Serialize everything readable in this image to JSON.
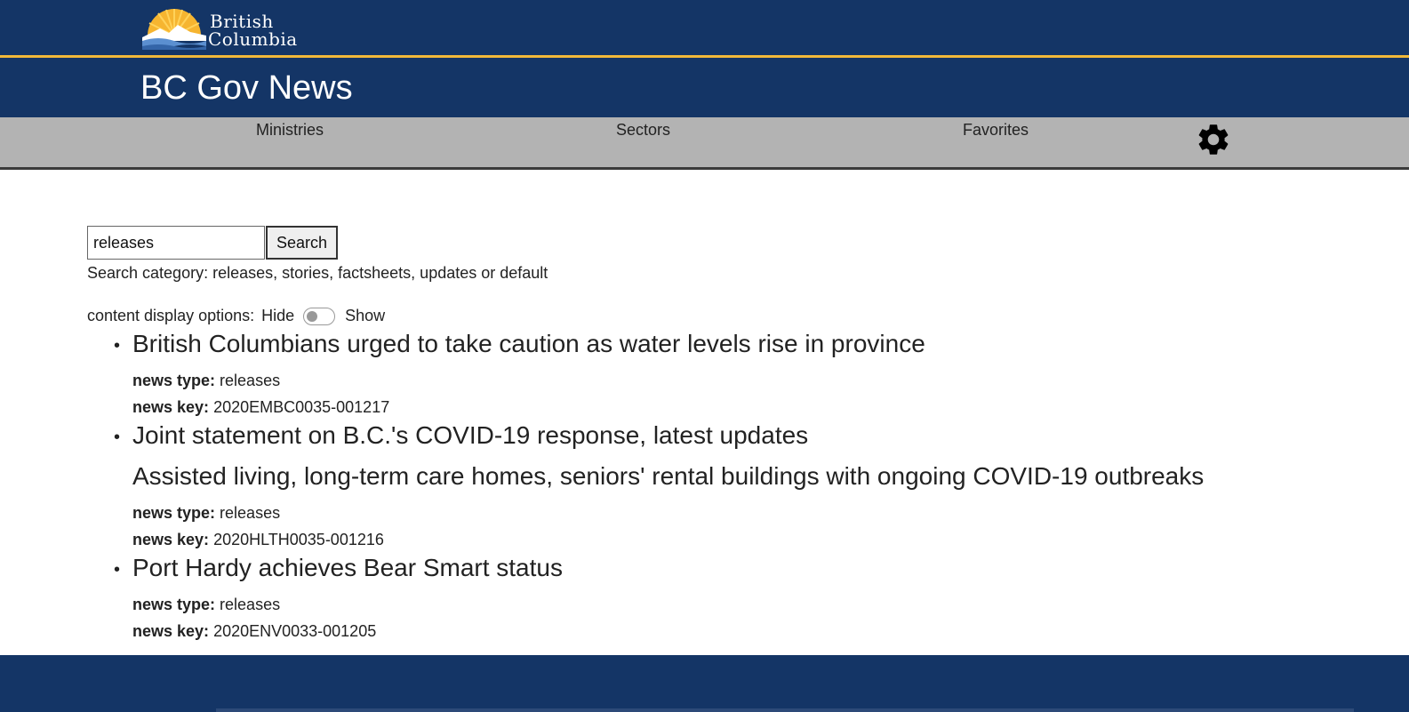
{
  "colors": {
    "header_bg": "#143566",
    "gold_accent": "#f1b83a",
    "nav_bg": "#b3b3b3"
  },
  "logo": {
    "line1": "British",
    "line2": "Columbia",
    "icon": "bc-sunset-logo-icon"
  },
  "header": {
    "title": "BC Gov News"
  },
  "nav": {
    "ministries": "Ministries",
    "sectors": "Sectors",
    "favorites": "Favorites",
    "settings_icon": "gear-icon"
  },
  "search": {
    "value": "releases",
    "button_label": "Search",
    "hint": "Search category: releases, stories, factsheets, updates or default"
  },
  "display_options": {
    "label": "content display options:",
    "hide": "Hide",
    "show": "Show",
    "toggle_on": false
  },
  "results": [
    {
      "title": "British Columbians urged to take caution as water levels rise in province",
      "subtitle": "",
      "type_label": "news type:",
      "type": "releases",
      "key_label": "news key:",
      "key": "2020EMBC0035-001217"
    },
    {
      "title": "Joint statement on B.C.'s COVID-19 response, latest updates",
      "subtitle": "Assisted living, long-term care homes, seniors' rental buildings with ongoing COVID-19 outbreaks",
      "type_label": "news type:",
      "type": "releases",
      "key_label": "news key:",
      "key": "2020HLTH0035-001216"
    },
    {
      "title": "Port Hardy achieves Bear Smart status",
      "subtitle": "",
      "type_label": "news type:",
      "type": "releases",
      "key_label": "news key:",
      "key": "2020ENV0033-001205"
    }
  ]
}
